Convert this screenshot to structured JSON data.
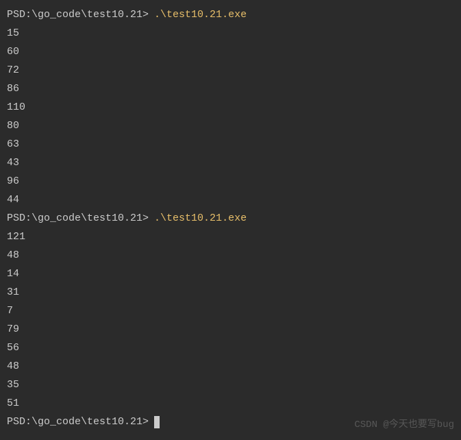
{
  "sessions": [
    {
      "prompt": {
        "prefix": "PS ",
        "path": "D:\\go_code\\test10.21>",
        "command": ".\\test10.21.exe"
      },
      "output": [
        "15",
        "60",
        "72",
        "86",
        "110",
        "80",
        "63",
        "43",
        "96",
        "44"
      ]
    },
    {
      "prompt": {
        "prefix": "PS ",
        "path": "D:\\go_code\\test10.21>",
        "command": ".\\test10.21.exe"
      },
      "output": [
        "121",
        "48",
        "14",
        "31",
        "7",
        "79",
        "56",
        "48",
        "35",
        "51"
      ]
    }
  ],
  "final_prompt": {
    "prefix": "PS ",
    "path": "D:\\go_code\\test10.21>"
  },
  "watermark": "CSDN @今天也要写bug"
}
